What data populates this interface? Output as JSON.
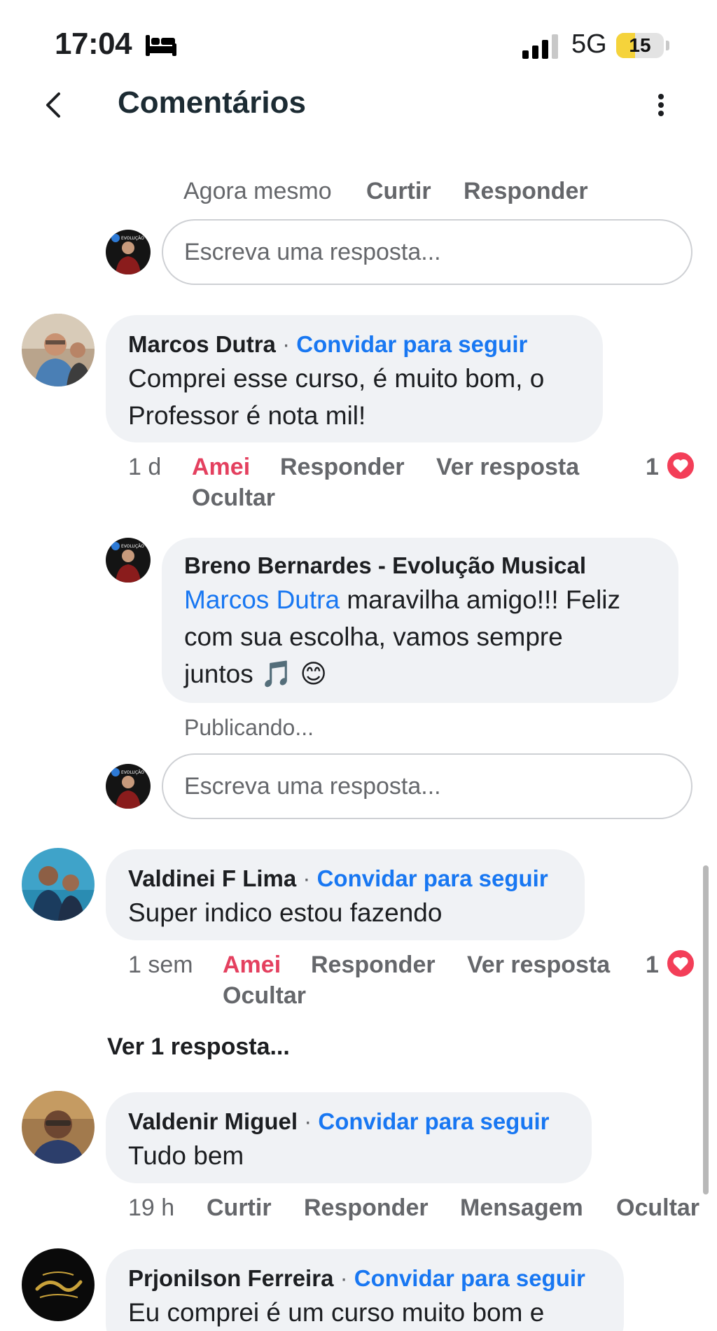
{
  "status_bar": {
    "time": "17:04",
    "network": "5G",
    "battery_level": "15",
    "battery_fraction": 0.15
  },
  "header": {
    "title": "Comentários"
  },
  "top_meta": {
    "time": "Agora mesmo",
    "like": "Curtir",
    "reply": "Responder"
  },
  "reply_placeholder": "Escreva uma resposta...",
  "comments": [
    {
      "author": "Marcos Dutra",
      "separator": "·",
      "invite": "Convidar para seguir",
      "text": "Comprei esse curso, é muito bom, o Professor é nota mil!",
      "time": "1 d",
      "reaction": "Amei",
      "reply": "Responder",
      "view_reply": "Ver resposta",
      "hide": "Ocultar",
      "reaction_count": "1"
    },
    {
      "author": "Valdinei F Lima",
      "separator": "·",
      "invite": "Convidar para seguir",
      "text": "Super indico estou fazendo",
      "time": "1 sem",
      "reaction": "Amei",
      "reply": "Responder",
      "view_reply": "Ver resposta",
      "hide": "Ocultar",
      "reaction_count": "1"
    },
    {
      "author": "Valdenir Miguel",
      "separator": "·",
      "invite": "Convidar para seguir",
      "text": "Tudo bem",
      "time": "19 h",
      "like": "Curtir",
      "reply": "Responder",
      "message": "Mensagem",
      "hide": "Ocultar"
    },
    {
      "author": "Prjonilson Ferreira",
      "separator": "·",
      "invite": "Convidar para seguir",
      "text": "Eu comprei é um curso muito bom e"
    }
  ],
  "page_reply": {
    "author": "Breno Bernardes - Evolução Musical",
    "mention": "Marcos Dutra",
    "text_line1": " maravilha amigo!!! Feliz",
    "text_line2": "com sua escolha, vamos sempre",
    "text_line3": "juntos 🎵 😊",
    "status": "Publicando..."
  },
  "view_replies_link": "Ver 1 resposta...",
  "avatar_logo_text": "EVOLUÇÃO",
  "colors": {
    "link_blue": "#1877f2",
    "love_red": "#e4405f",
    "heart_badge": "#f33e58",
    "bubble_bg": "#f0f2f5",
    "meta_gray": "#65676b",
    "battery_yellow": "#f5d33b"
  },
  "icons": [
    "bed-icon",
    "signal-icon",
    "back-chevron-icon",
    "more-vertical-icon",
    "heart-icon"
  ]
}
